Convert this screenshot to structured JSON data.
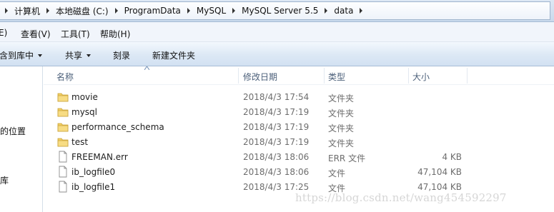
{
  "address_bar": {
    "crumbs": [
      "计算机",
      "本地磁盘 (C:)",
      "ProgramData",
      "MySQL",
      "MySQL Server 5.5",
      "data"
    ]
  },
  "menu": {
    "items": [
      "E)",
      "查看(V)",
      "工具(T)",
      "帮助(H)"
    ]
  },
  "toolbar": {
    "include_library": "含到库中",
    "share": "共享",
    "burn": "刻录",
    "new_folder": "新建文件夹"
  },
  "nav": {
    "items": [
      "的位置",
      "库"
    ]
  },
  "columns": {
    "name": "名称",
    "modified": "修改日期",
    "type": "类型",
    "size": "大小"
  },
  "files": [
    {
      "name": "movie",
      "modified": "2018/4/3 17:54",
      "type": "文件夹",
      "size": "",
      "icon": "folder-icon"
    },
    {
      "name": "mysql",
      "modified": "2018/4/3 17:19",
      "type": "文件夹",
      "size": "",
      "icon": "folder-icon"
    },
    {
      "name": "performance_schema",
      "modified": "2018/4/3 17:19",
      "type": "文件夹",
      "size": "",
      "icon": "folder-icon"
    },
    {
      "name": "test",
      "modified": "2018/4/3 17:19",
      "type": "文件夹",
      "size": "",
      "icon": "folder-icon"
    },
    {
      "name": "FREEMAN.err",
      "modified": "2018/4/3 18:06",
      "type": "ERR 文件",
      "size": "4 KB",
      "icon": "file-icon"
    },
    {
      "name": "ib_logfile0",
      "modified": "2018/4/3 18:06",
      "type": "文件",
      "size": "47,104 KB",
      "icon": "file-icon"
    },
    {
      "name": "ib_logfile1",
      "modified": "2018/4/3 17:25",
      "type": "文件",
      "size": "47,104 KB",
      "icon": "file-icon"
    }
  ],
  "watermark": "https://blog.csdn.net/wang454592297",
  "colors": {
    "folder": "#f2cf63",
    "header_text": "#4c607a",
    "toolbar_bg": "#dce8f5"
  }
}
